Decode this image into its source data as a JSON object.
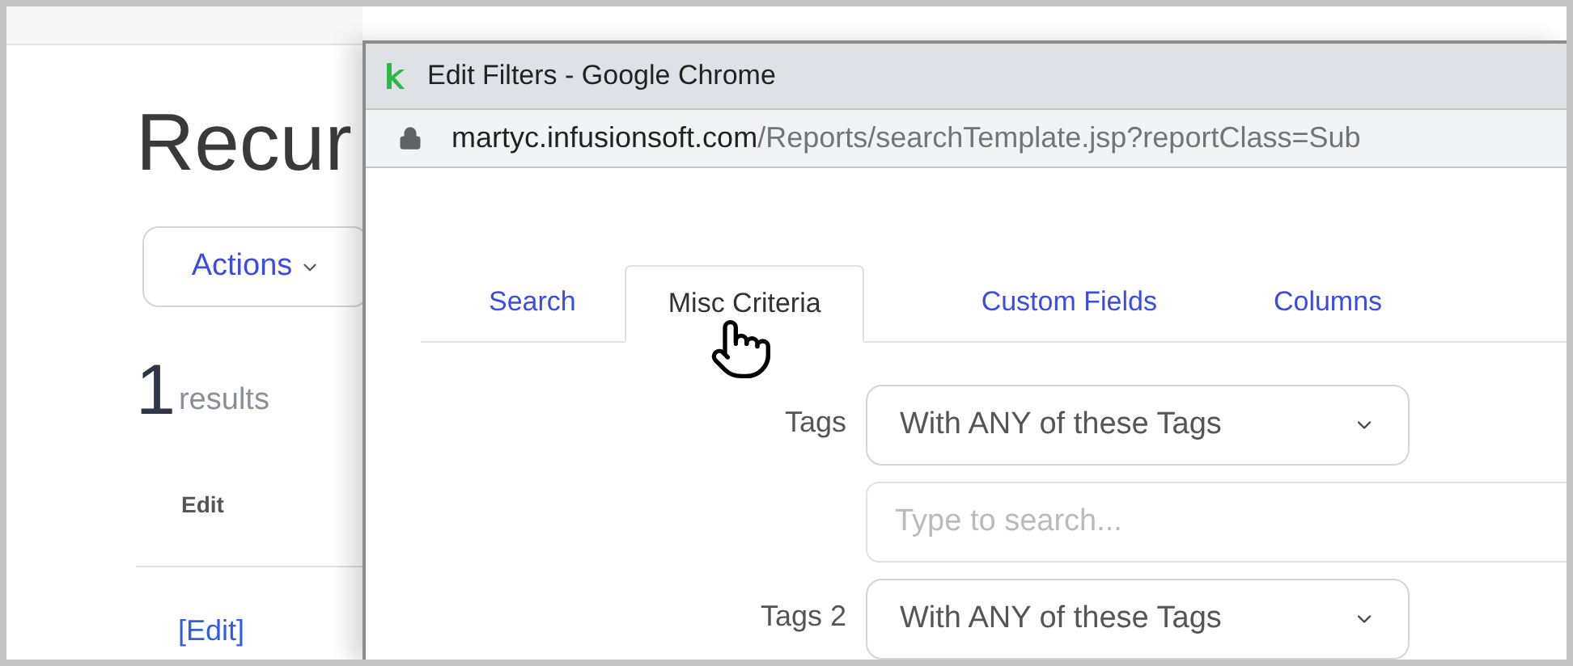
{
  "page": {
    "title": "Recur",
    "actions_button": "Actions",
    "result_count": "1",
    "result_label": "results",
    "column_header": "Edit",
    "row_link": "[Edit]"
  },
  "popup": {
    "window_title": "Edit Filters - Google Chrome",
    "url_host": "martyc.infusionsoft.com",
    "url_path": "/Reports/searchTemplate.jsp?reportClass=Sub",
    "tabs": [
      {
        "label": "Search",
        "selected": false
      },
      {
        "label": "Misc Criteria",
        "selected": true
      },
      {
        "label": "Custom Fields",
        "selected": false
      },
      {
        "label": "Columns",
        "selected": false
      }
    ],
    "fields": [
      {
        "kind": "select",
        "label": "Tags",
        "value": "With ANY of these Tags"
      },
      {
        "kind": "search",
        "placeholder": "Type to search..."
      },
      {
        "kind": "select",
        "label": "Tags 2",
        "value": "With ANY of these Tags"
      }
    ]
  }
}
